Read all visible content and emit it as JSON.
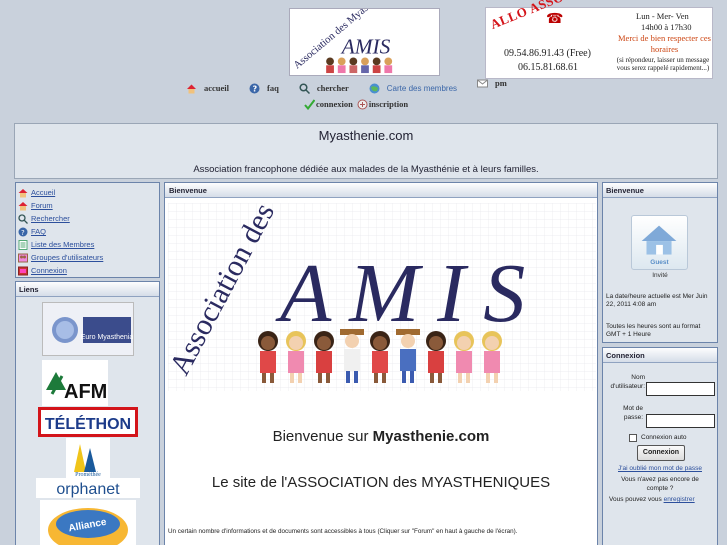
{
  "top": {
    "logo_top_text": "Association des Myasthéniques",
    "logo_top_amis": "AMIS",
    "allo": {
      "title": "ALLO ASSOCIATION AMIS",
      "number1": "09.54.86.91.43 (Free)",
      "number2": "06.15.81.68.61",
      "days": "Lun - Mer- Ven",
      "hours": "14h00 à 17h30",
      "respect": "Merci de bien respecter ces horaires",
      "repondeur": "(si répondeur, laisser un message vous serez rappelé rapidement...)"
    }
  },
  "nav": {
    "accueil": "accueil",
    "faq": "faq",
    "chercher": "chercher",
    "carte": "Carte des membres",
    "pm": "pm",
    "connexion": "connexion",
    "inscription": "inscription"
  },
  "header": {
    "title": "Myasthenie.com",
    "description": "Association francophone dédiée aux malades de la Myasthénie et à leurs familles."
  },
  "menu": {
    "items": [
      {
        "label": "Accueil",
        "icon": "house-icon"
      },
      {
        "label": "Forum",
        "icon": "house-icon"
      },
      {
        "label": "Rechercher",
        "icon": "search-icon"
      },
      {
        "label": "FAQ",
        "icon": "help-icon"
      },
      {
        "label": "Liste des Membres",
        "icon": "members-icon"
      },
      {
        "label": "Groupes d'utilisateurs",
        "icon": "groups-icon"
      },
      {
        "label": "Connexion",
        "icon": "login-icon"
      }
    ]
  },
  "liens": {
    "title": "Liens",
    "euro": "Euro Myasthenia",
    "afm": "AFM",
    "telethon": "TÉLÉTHON",
    "prometheo": "Prométhée",
    "orphanet": "orphanet",
    "alliance": "Alliance"
  },
  "center": {
    "title": "Bienvenue",
    "logo_text": "Association des Myasthéniques",
    "logo_amis": "AMIS",
    "welcome_prefix": "Bienvenue sur ",
    "welcome_site": "Myasthenie.com",
    "association_line": "Le site de l'ASSOCIATION des MYASTHENIQUES",
    "note": "Un certain nombre d'informations et de documents sont accessibles à tous (Cliquer sur \"Forum\" en haut à gauche de l'écran)."
  },
  "bienvenue": {
    "title": "Bienvenue",
    "guest": "Guest",
    "invite": "Invité",
    "date_info": "La date/heure actuelle est Mer Juin 22, 2011 4:08 am",
    "tz_info": "Toutes les heures sont au format GMT + 1 Heure"
  },
  "connexion": {
    "title": "Connexion",
    "username_label1": "Nom",
    "username_label2": "d'utilisateur:",
    "password_label1": "Mot de",
    "password_label2": "passe:",
    "remember": "Connexion auto",
    "button": "Connexion",
    "forgot": "J'ai oublié mon mot de passe",
    "no_account": "Vous n'avez pas encore de compte ?",
    "can_prefix": "Vous pouvez vous ",
    "register": "enregistrer"
  },
  "colors": {
    "link": "#2c4f9c",
    "allo_red": "#d4141a",
    "background": "#c9d1dc"
  }
}
